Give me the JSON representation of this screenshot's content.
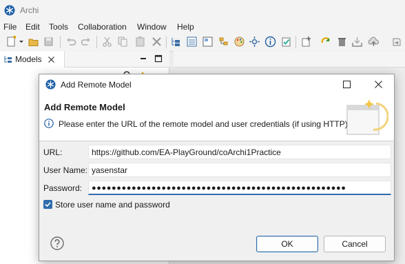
{
  "app": {
    "title": "Archi",
    "icon": "archi-logo-icon"
  },
  "menubar": {
    "items": [
      "File",
      "Edit",
      "Tools",
      "Collaboration",
      "Window",
      "Help"
    ]
  },
  "models_panel": {
    "tab_label": "Models"
  },
  "dialog": {
    "title": "Add Remote Model",
    "header_title": "Add Remote Model",
    "message": "Please enter the URL of the remote model and user credentials (if using HTTP)",
    "fields": {
      "url": {
        "label": "URL:",
        "value": "https://github.com/EA-PlayGround/coArchi1Practice"
      },
      "username": {
        "label": "User Name:",
        "value": "yasenstar"
      },
      "password": {
        "label": "Password:",
        "value": "●●●●●●●●●●●●●●●●●●●●●●●●●●●●●●●●●●●●●●●●●●●●●●●●●●●"
      }
    },
    "store_credentials": {
      "label": "Store user name and password",
      "checked": true
    },
    "buttons": {
      "ok": "OK",
      "cancel": "Cancel"
    }
  },
  "colors": {
    "accent": "#2f6dac",
    "archi_blue": "#1d5fa8"
  }
}
